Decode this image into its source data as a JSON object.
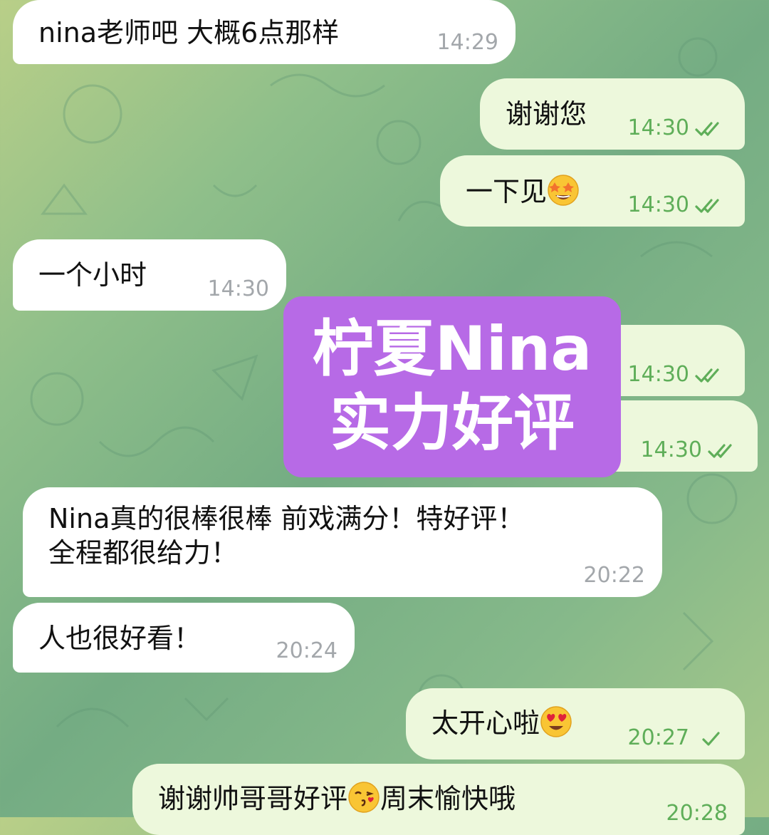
{
  "messages": [
    {
      "text": "nina老师吧 大概6点那样",
      "time": "14:29"
    },
    {
      "text": "谢谢您",
      "time": "14:30"
    },
    {
      "text": "一下见",
      "emoji": "star-struck-emoji",
      "time": "14:30"
    },
    {
      "text": "一个小时",
      "time": "14:30"
    },
    {
      "text": "",
      "time": "14:30"
    },
    {
      "text": "",
      "time": "14:30"
    },
    {
      "line1": "Nina真的很棒很棒 前戏满分！特好评！",
      "line2": "全程都很给力！",
      "time": "20:22"
    },
    {
      "text": "人也很好看！",
      "time": "20:24"
    },
    {
      "text": "太开心啦",
      "emoji": "heart-eyes-emoji",
      "time": "20:27"
    },
    {
      "text": "谢谢帅哥哥好评",
      "emoji": "kissing-heart-emoji",
      "text_after": "周末愉快哦",
      "time": "20:28"
    }
  ],
  "overlay": {
    "line1": "柠夏Nina",
    "line2": "实力好评"
  },
  "colors": {
    "incoming_bubble": "#ffffff",
    "outgoing_bubble": "#edf8dc",
    "outgoing_time": "#5fae59",
    "incoming_time": "#a3a7ab",
    "overlay_bg": "#b76ae6"
  }
}
